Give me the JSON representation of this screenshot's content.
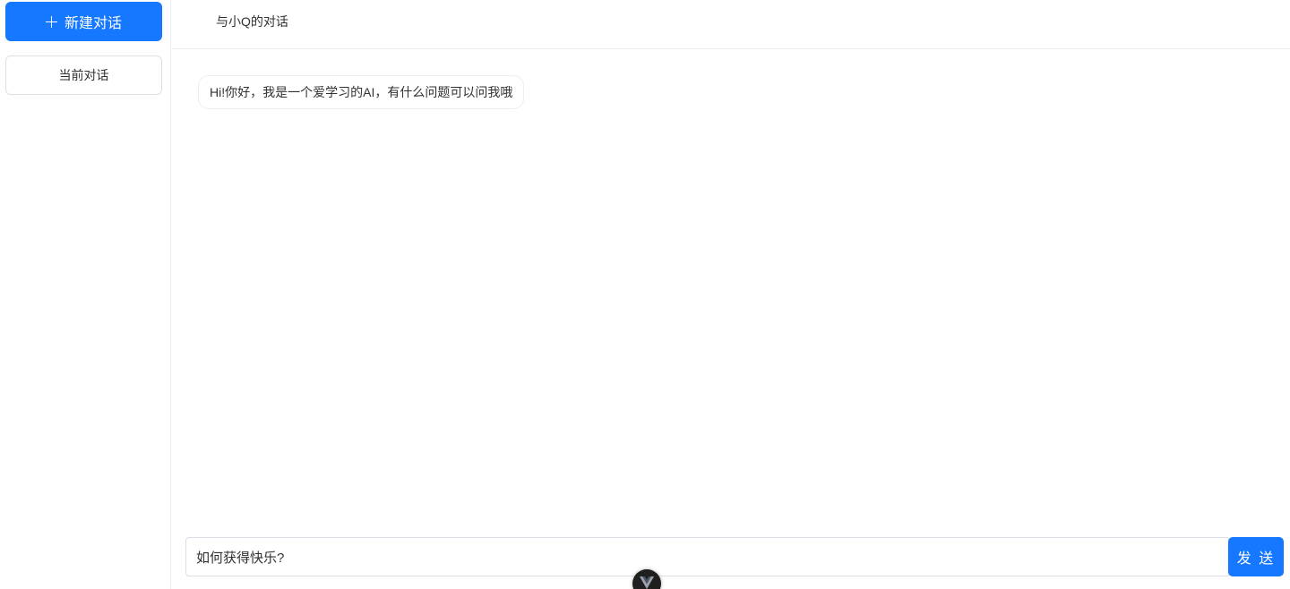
{
  "sidebar": {
    "new_chat_label": "新建对话",
    "conversations": [
      {
        "label": "当前对话"
      }
    ]
  },
  "header": {
    "title": "与小Q的对话"
  },
  "messages": [
    {
      "role": "assistant",
      "text": "Hi!你好，我是一个爱学习的AI，有什么问题可以问我哦"
    }
  ],
  "composer": {
    "value": "如何获得快乐?",
    "send_label": "发 送"
  },
  "colors": {
    "accent": "#1677ff",
    "border": "#dcdfe6",
    "divider": "#ebeef5"
  },
  "icons": {
    "new_chat": "plus-icon",
    "devtools": "vue-logo-icon"
  }
}
